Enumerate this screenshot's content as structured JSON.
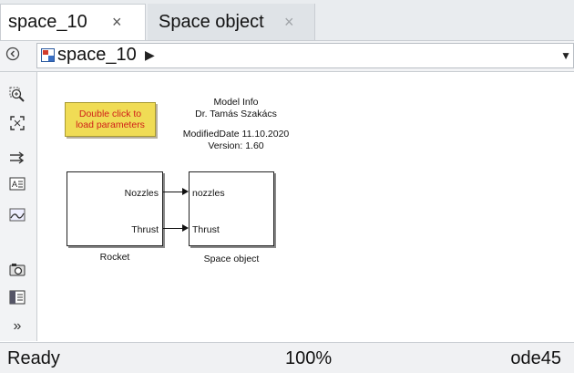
{
  "tabs": [
    {
      "label": "space_10",
      "close": "×",
      "active": true
    },
    {
      "label": "Space object",
      "close": "×",
      "active": false
    }
  ],
  "address": {
    "path": "space_10"
  },
  "annotation": {
    "line1": "Double click to",
    "line2": "load parameters"
  },
  "model_info": {
    "title": "Model Info",
    "author": "Dr. Tamás Szakács",
    "modified": "ModifiedDate 11.10.2020",
    "version": "Version: 1.60"
  },
  "blocks": {
    "rocket": {
      "name": "Rocket",
      "outputs": [
        "Nozzles",
        "Thrust"
      ]
    },
    "space_object": {
      "name": "Space object",
      "inputs": [
        "nozzles",
        "Thrust"
      ]
    }
  },
  "status": {
    "ready": "Ready",
    "zoom": "100%",
    "solver": "ode45"
  },
  "colors": {
    "annotation_bg": "#f0dc55",
    "annotation_text": "#d0201a"
  }
}
